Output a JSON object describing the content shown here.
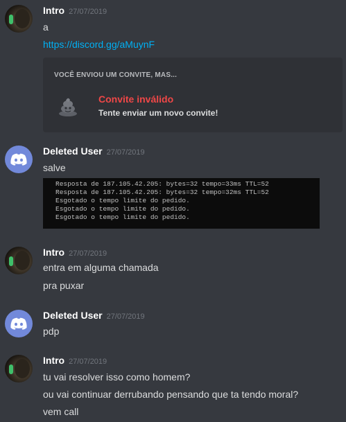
{
  "messages": [
    {
      "username": "Intro",
      "timestamp": "27/07/2019",
      "avatar": "user-photo",
      "lines": [
        "a"
      ],
      "link": "https://discord.gg/aMuynF",
      "invite": {
        "title": "VOCÊ ENVIOU UM CONVITE, MAS...",
        "status": "Convite inválido",
        "subtitle": "Tente enviar um novo convite!",
        "icon": "poop-icon"
      }
    },
    {
      "username": "Deleted User",
      "timestamp": "27/07/2019",
      "avatar": "discord-default",
      "lines": [
        "salve"
      ],
      "terminal": [
        "Resposta de 187.105.42.205: bytes=32 tempo=33ms TTL=52",
        "Resposta de 187.105.42.205: bytes=32 tempo=32ms TTL=52",
        "Esgotado o tempo limite do pedido.",
        "Esgotado o tempo limite do pedido.",
        "Esgotado o tempo limite do pedido."
      ]
    },
    {
      "username": "Intro",
      "timestamp": "27/07/2019",
      "avatar": "user-photo",
      "lines": [
        "entra em alguma chamada",
        "pra puxar"
      ]
    },
    {
      "username": "Deleted User",
      "timestamp": "27/07/2019",
      "avatar": "discord-default",
      "lines": [
        "pdp"
      ]
    },
    {
      "username": "Intro",
      "timestamp": "27/07/2019",
      "avatar": "user-photo",
      "lines": [
        "tu vai resolver isso como homem?",
        "ou vai continuar derrubando pensando que ta tendo moral?",
        "vem call"
      ]
    }
  ],
  "colors": {
    "background": "#36393f",
    "embed": "#2f3136",
    "link": "#00b0f4",
    "error": "#f04747",
    "blurple": "#7289da"
  }
}
